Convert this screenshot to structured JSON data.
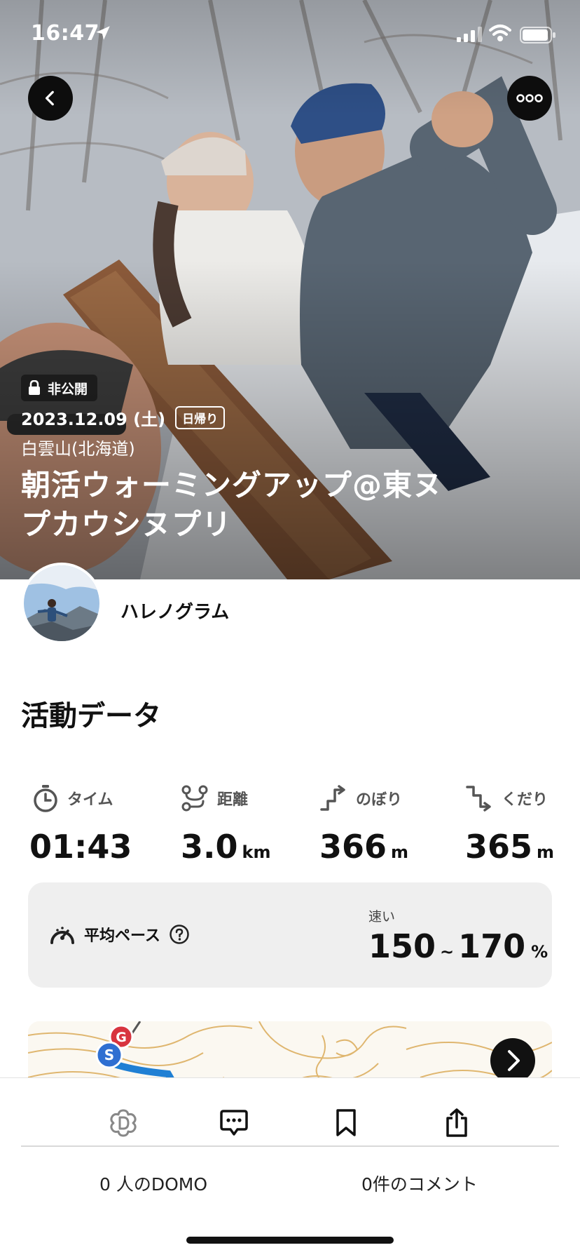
{
  "status_bar": {
    "time": "16:47"
  },
  "hero": {
    "privacy_label": "非公開",
    "date": "2023.12.09 (土)",
    "trip_type": "日帰り",
    "mountain": "白雲山(北海道)",
    "title": "朝活ウォーミングアップ@東ヌプカウシヌプリ"
  },
  "user": {
    "name": "ハレノグラム"
  },
  "activity": {
    "section_title": "活動データ",
    "stats": [
      {
        "label": "タイム",
        "value": "01:43",
        "unit": ""
      },
      {
        "label": "距離",
        "value": "3.0",
        "unit": "km"
      },
      {
        "label": "のぼり",
        "value": "366",
        "unit": "m"
      },
      {
        "label": "くだり",
        "value": "365",
        "unit": "m"
      }
    ],
    "pace": {
      "label": "平均ペース",
      "level": "速い",
      "min": "150",
      "separator": "~",
      "max": "170",
      "unit": "%"
    }
  },
  "map": {
    "start_marker": "S",
    "goal_marker": "G"
  },
  "bottom_bar": {
    "domo_count": "0 人のDOMO",
    "comment_count": "0件のコメント"
  },
  "colors": {
    "accent_blue": "#1f7fd4",
    "start_blue": "#2f6fd1",
    "goal_red": "#d8343f",
    "map_contour": "#d9a64f"
  }
}
